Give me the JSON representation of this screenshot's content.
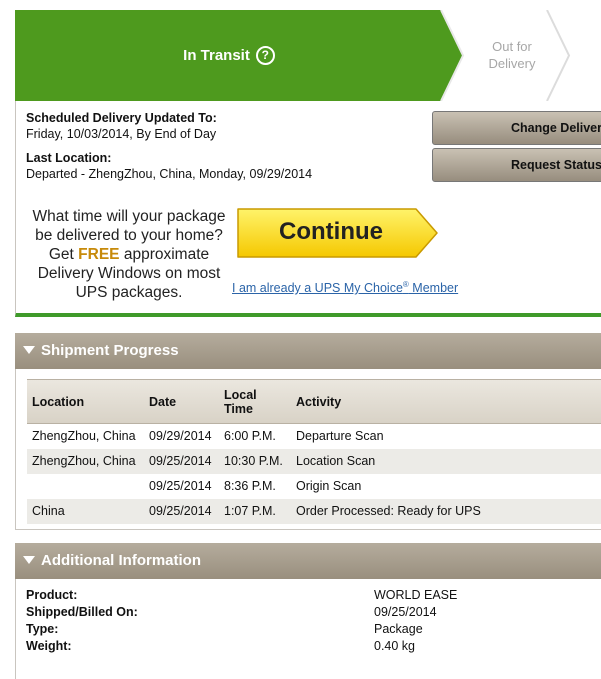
{
  "progress": {
    "current_step": "In Transit",
    "help_icon": "question-circle-icon",
    "next_step": "Out for Delivery",
    "colors": {
      "active": "#4e9a1e",
      "inactive_text": "#a7a7a7"
    }
  },
  "summary": {
    "scheduled_label": "Scheduled Delivery Updated To:",
    "scheduled_value": "Friday, 10/03/2014, By End of Day",
    "last_location_label": "Last Location:",
    "last_location_value": "Departed - ZhengZhou, China, Monday, 09/29/2014",
    "change_delivery_button": "Change Delivery",
    "request_status_button": "Request Status Updates"
  },
  "promo": {
    "text_part1": "What time will your package be delivered to your home? Get",
    "free": "FREE",
    "text_part2": "approximate Delivery Windows on most UPS packages.",
    "continue_button": "Continue",
    "member_link_text": "I am already a UPS My Choice",
    "member_link_sup": "®",
    "member_link_suffix": " Member"
  },
  "shipment_progress": {
    "title": "Shipment Progress",
    "columns": {
      "location": "Location",
      "date": "Date",
      "time_line1": "Local",
      "time_line2": "Time",
      "activity": "Activity"
    },
    "rows": [
      {
        "location": "ZhengZhou, China",
        "date": "09/29/2014",
        "time": "6:00 P.M.",
        "activity": "Departure Scan"
      },
      {
        "location": "ZhengZhou, China",
        "date": "09/25/2014",
        "time": "10:30 P.M.",
        "activity": "Location Scan"
      },
      {
        "location": "",
        "date": "09/25/2014",
        "time": "8:36 P.M.",
        "activity": "Origin Scan"
      },
      {
        "location": "China",
        "date": "09/25/2014",
        "time": "1:07 P.M.",
        "activity": "Order Processed: Ready for UPS"
      }
    ]
  },
  "additional_info": {
    "title": "Additional Information",
    "product_label": "Product:",
    "product_value": "WORLD EASE",
    "shipped_label": "Shipped/Billed On:",
    "shipped_value": "09/25/2014",
    "type_label": "Type:",
    "type_value": "Package",
    "weight_label": "Weight:",
    "weight_value": "0.40 kg"
  }
}
